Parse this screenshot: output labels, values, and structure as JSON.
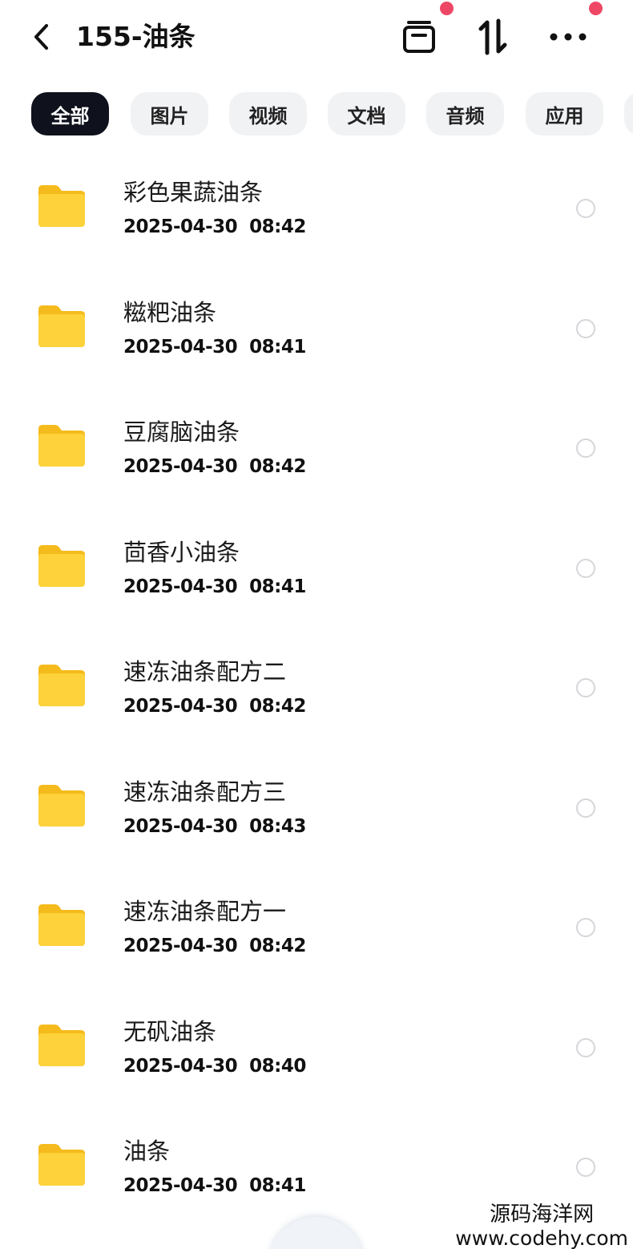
{
  "header": {
    "title": "155-油条",
    "icons": [
      "back-icon",
      "archive-box-icon",
      "sort-icon",
      "more-icon"
    ],
    "notification_dot_color": "#ee4766"
  },
  "filters": [
    {
      "label": "全部",
      "active": true
    },
    {
      "label": "图片",
      "active": false
    },
    {
      "label": "视频",
      "active": false
    },
    {
      "label": "文档",
      "active": false
    },
    {
      "label": "音频",
      "active": false
    },
    {
      "label": "应用",
      "active": false
    }
  ],
  "files": [
    {
      "name": "彩色果蔬油条",
      "date": "2025-04-30  08:42",
      "icon": "folder-icon"
    },
    {
      "name": "糍粑油条",
      "date": "2025-04-30  08:41",
      "icon": "folder-icon"
    },
    {
      "name": "豆腐脑油条",
      "date": "2025-04-30  08:42",
      "icon": "folder-icon"
    },
    {
      "name": "茴香小油条",
      "date": "2025-04-30  08:41",
      "icon": "folder-icon"
    },
    {
      "name": "速冻油条配方二",
      "date": "2025-04-30  08:42",
      "icon": "folder-icon"
    },
    {
      "name": "速冻油条配方三",
      "date": "2025-04-30  08:43",
      "icon": "folder-icon"
    },
    {
      "name": "速冻油条配方一",
      "date": "2025-04-30  08:42",
      "icon": "folder-icon"
    },
    {
      "name": "无矾油条",
      "date": "2025-04-30  08:40",
      "icon": "folder-icon"
    },
    {
      "name": "油条",
      "date": "2025-04-30  08:41",
      "icon": "folder-icon"
    }
  ],
  "watermark": {
    "line1": "源码海洋网",
    "line2": "www.codehy.com"
  },
  "colors": {
    "folder": "#fccb2e",
    "active_chip": "#0f111c",
    "chip_bg": "#f1f2f4"
  }
}
